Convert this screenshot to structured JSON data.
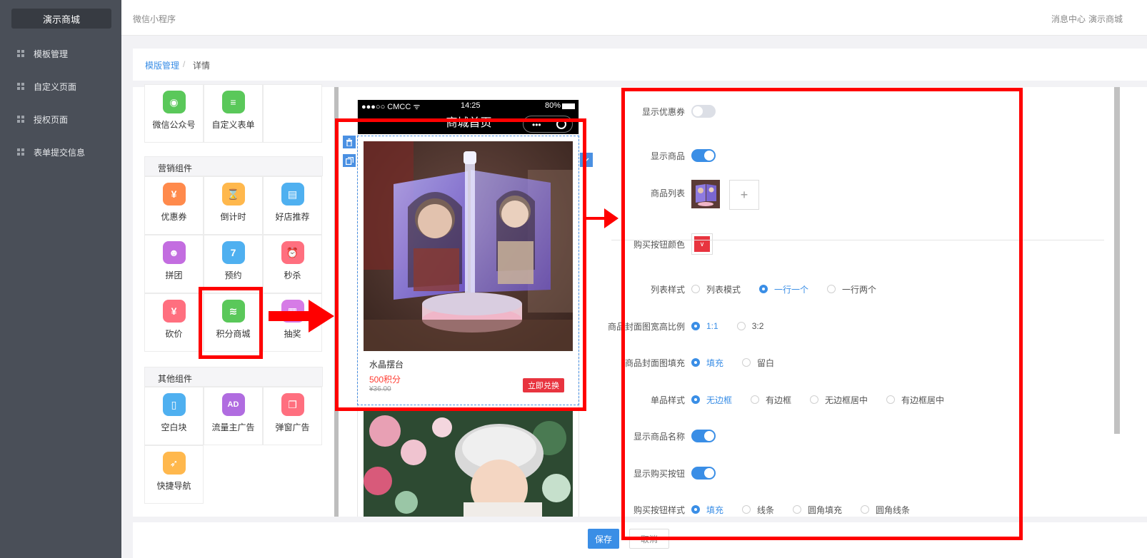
{
  "sidebar": {
    "brand": "演示商城",
    "items": [
      {
        "label": "模板管理"
      },
      {
        "label": "自定义页面"
      },
      {
        "label": "授权页面"
      },
      {
        "label": "表单提交信息"
      }
    ]
  },
  "topbar": {
    "title": "微信小程序",
    "message_center": "消息中心",
    "store": "演示商城"
  },
  "breadcrumb": {
    "parent": "模版管理",
    "separator": "/",
    "current": "详情"
  },
  "components": {
    "top_items": [
      {
        "label": "微信公众号",
        "icon": "wechat-icon",
        "glyph": "◉"
      },
      {
        "label": "自定义表单",
        "icon": "form-icon",
        "glyph": "≡"
      }
    ],
    "marketing_title": "营销组件",
    "marketing": [
      {
        "label": "优惠券",
        "icon": "coupon-icon",
        "glyph": "¥"
      },
      {
        "label": "倒计时",
        "icon": "hourglass-icon",
        "glyph": "⌛"
      },
      {
        "label": "好店推荐",
        "icon": "shop-icon",
        "glyph": "▤"
      },
      {
        "label": "拼团",
        "icon": "group-icon",
        "glyph": "☻"
      },
      {
        "label": "预约",
        "icon": "calendar-icon",
        "glyph": "7"
      },
      {
        "label": "秒杀",
        "icon": "alarm-clock-icon",
        "glyph": "⏰"
      },
      {
        "label": "砍价",
        "icon": "bargain-icon",
        "glyph": "¥"
      },
      {
        "label": "积分商城",
        "icon": "coins-icon",
        "glyph": "≋"
      },
      {
        "label": "抽奖",
        "icon": "gift-icon",
        "glyph": "▦"
      }
    ],
    "other_title": "其他组件",
    "other": [
      {
        "label": "空白块",
        "icon": "blank-icon",
        "glyph": "▯"
      },
      {
        "label": "流量主广告",
        "icon": "ad-icon",
        "glyph": "AD"
      },
      {
        "label": "弹窗广告",
        "icon": "popup-icon",
        "glyph": "❐"
      },
      {
        "label": "快捷导航",
        "icon": "compass-icon",
        "glyph": "➶"
      }
    ]
  },
  "phone": {
    "carrier": "●●●○○ CMCC ᯤ",
    "time": "14:25",
    "battery": "80%",
    "page_title": "商城首页",
    "capsule_dots": "•••",
    "product": {
      "name": "水晶摆台",
      "points": "500积分",
      "old_price": "¥36.00",
      "buy_label": "立即兑换"
    }
  },
  "settings": {
    "show_coupon": {
      "label": "显示优惠券",
      "on": false
    },
    "show_goods": {
      "label": "显示商品",
      "on": true
    },
    "goods_list": {
      "label": "商品列表",
      "add": "+"
    },
    "buy_color": {
      "label": "购买按钮颜色",
      "value": "#e8343f",
      "arrow": "∨"
    },
    "list_style": {
      "label": "列表样式",
      "options": [
        "列表模式",
        "一行一个",
        "一行两个"
      ],
      "selected": 1
    },
    "cover_ratio": {
      "label": "商品封面图宽高比例",
      "options": [
        "1:1",
        "3:2"
      ],
      "selected": 0
    },
    "cover_fill": {
      "label": "商品封面图填充",
      "options": [
        "填充",
        "留白"
      ],
      "selected": 0
    },
    "item_style": {
      "label": "单品样式",
      "options": [
        "无边框",
        "有边框",
        "无边框居中",
        "有边框居中"
      ],
      "selected": 0
    },
    "show_name": {
      "label": "显示商品名称",
      "on": true
    },
    "show_buy": {
      "label": "显示购买按钮",
      "on": true
    },
    "buy_style": {
      "label": "购买按钮样式",
      "options": [
        "填充",
        "线条",
        "圆角填充",
        "圆角线条"
      ],
      "selected": 0
    }
  },
  "footer": {
    "save": "保存",
    "cancel": "取消"
  },
  "colors": {
    "accent": "#3a8ee6",
    "sidebar": "#4a4f58",
    "annotation": "#ff0000",
    "buy_button": "#e8343f"
  }
}
